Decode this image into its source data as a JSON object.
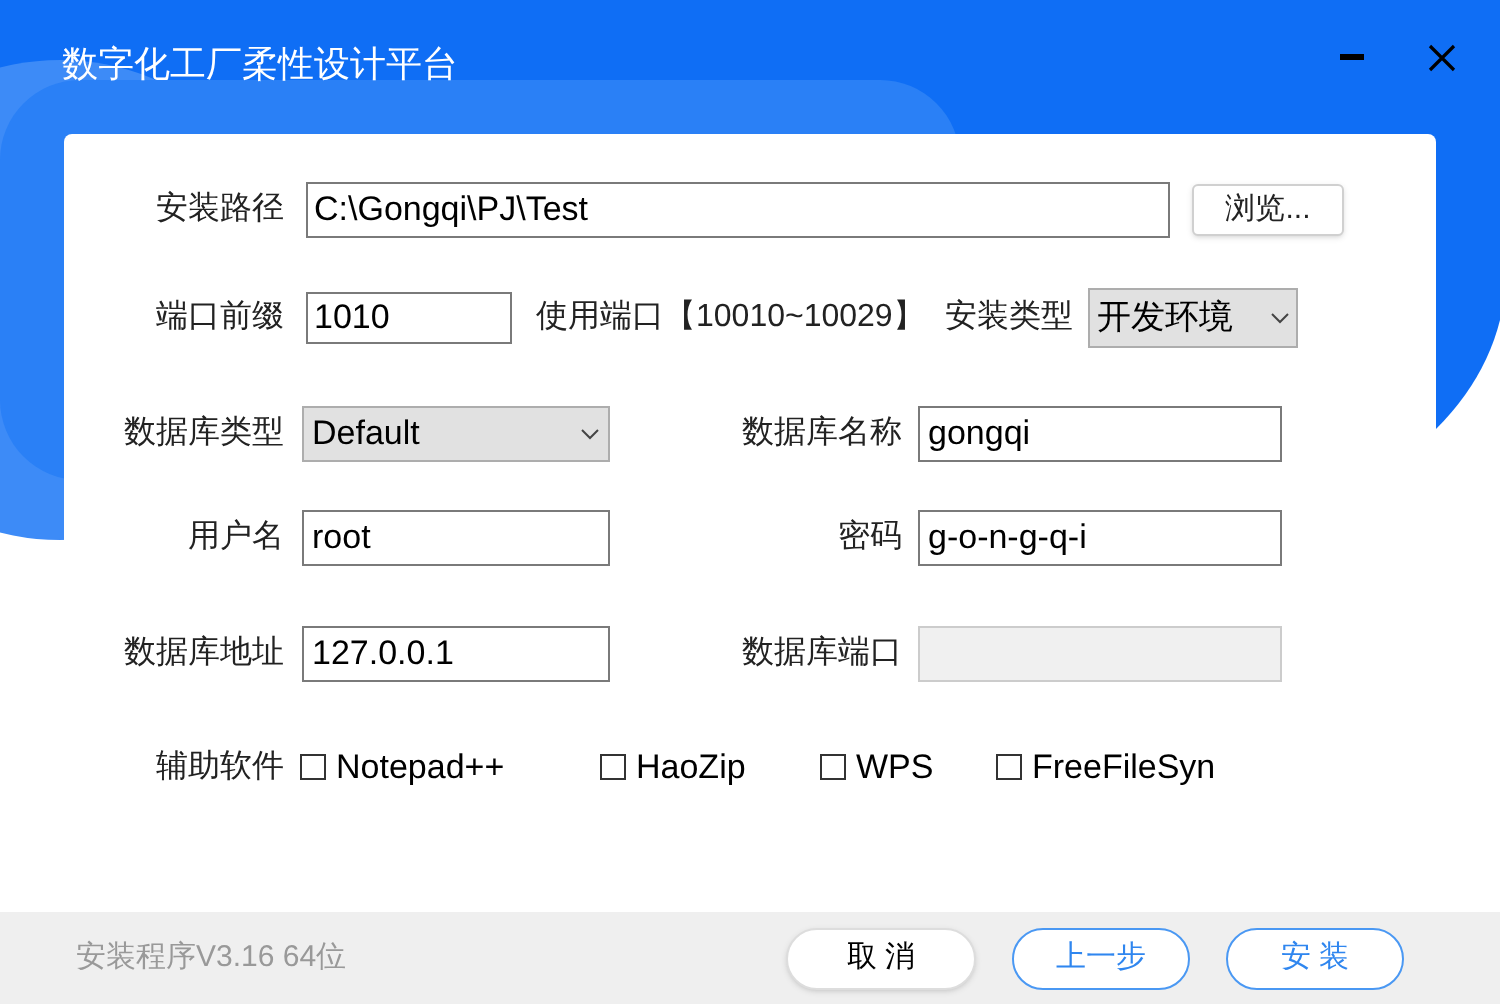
{
  "window": {
    "title": "数字化工厂柔性设计平台"
  },
  "install_path": {
    "label": "安装路径",
    "value": "C:\\Gongqi\\PJ\\Test",
    "button": "浏览..."
  },
  "port_row": {
    "label": "端口前缀",
    "value": "1010",
    "ports": "使用端口【10010~10029】",
    "type_label": "安装类型",
    "type_value": "开发环境"
  },
  "db_rows": [
    {
      "left": {
        "label": "数据库类型",
        "kind": "select",
        "value": "Default"
      },
      "right": {
        "label": "数据库名称",
        "kind": "input",
        "value": "gongqi"
      }
    },
    {
      "left": {
        "label": "用户名",
        "kind": "input",
        "value": "root"
      },
      "right": {
        "label": "密码",
        "kind": "input",
        "value": "g-o-n-g-q-i"
      }
    },
    {
      "left": {
        "label": "数据库地址",
        "kind": "input",
        "value": "127.0.0.1"
      },
      "right": {
        "label": "数据库端口",
        "kind": "input",
        "disabled": true
      }
    }
  ],
  "tools": {
    "label": "辅助软件",
    "items": [
      {
        "label": "Notepad++",
        "checked": false
      },
      {
        "label": "HaoZip",
        "checked": false
      },
      {
        "label": "WPS",
        "checked": false
      },
      {
        "label": "FreeFileSyn",
        "checked": false
      }
    ]
  },
  "footer": {
    "version": "安装程序V3.16 64位",
    "buttons": [
      {
        "label": "取 消",
        "kind": "plain"
      },
      {
        "label": "上一步",
        "kind": "primary"
      },
      {
        "label": "安 装",
        "kind": "primary"
      }
    ]
  }
}
